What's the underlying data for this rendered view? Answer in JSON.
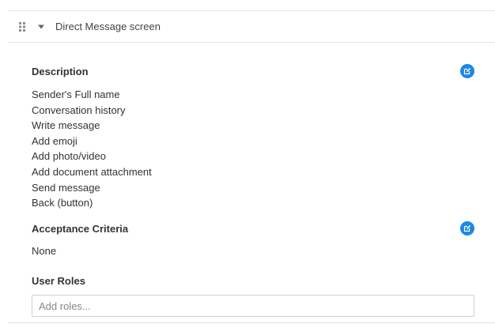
{
  "panel": {
    "title": "Direct Message screen"
  },
  "description": {
    "heading": "Description",
    "items": [
      "Sender's Full name",
      "Conversation history",
      "Write message",
      "Add emoji",
      "Add photo/video",
      "Add document attachment",
      "Send message",
      "Back (button)"
    ]
  },
  "acceptance_criteria": {
    "heading": "Acceptance Criteria",
    "value": "None"
  },
  "user_roles": {
    "heading": "User Roles",
    "placeholder": "Add roles...",
    "value": ""
  },
  "colors": {
    "accent": "#1e88e5",
    "border": "#e4e4e4",
    "icon_gray": "#888888"
  },
  "icons": {
    "drag": "drag-handle-icon",
    "caret": "caret-down-icon",
    "edit": "edit-icon"
  }
}
